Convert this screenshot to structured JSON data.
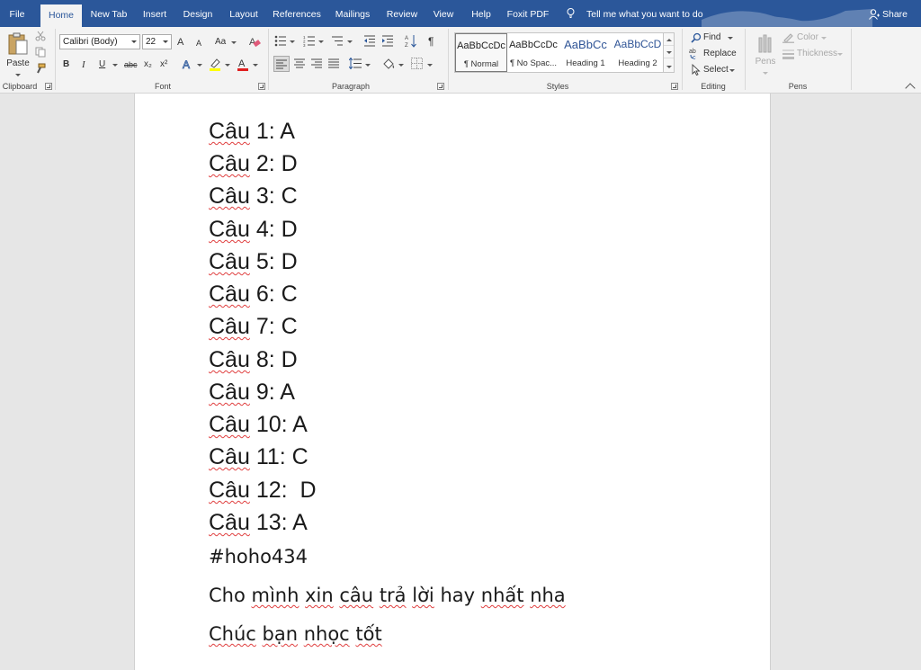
{
  "tabs": [
    "File",
    "Home",
    "New Tab",
    "Insert",
    "Design",
    "Layout",
    "References",
    "Mailings",
    "Review",
    "View",
    "Help",
    "Foxit PDF"
  ],
  "active_tab": "Home",
  "tell_me": "Tell me what you want to do",
  "share": "Share",
  "clipboard": {
    "paste": "Paste",
    "group": "Clipboard"
  },
  "font": {
    "name": "Calibri (Body)",
    "size": "22",
    "group": "Font",
    "bold": "B",
    "italic": "I",
    "underline": "U",
    "strike": "abc",
    "sub": "x₂",
    "sup": "x²",
    "grow": "A",
    "shrink": "A",
    "case": "Aa"
  },
  "paragraph": {
    "group": "Paragraph",
    "pilcrow": "¶"
  },
  "styles": {
    "group": "Styles",
    "items": [
      {
        "sample": "AaBbCcDc",
        "name": "¶ Normal"
      },
      {
        "sample": "AaBbCcDc",
        "name": "¶ No Spac..."
      },
      {
        "sample": "AaBbCc",
        "name": "Heading 1"
      },
      {
        "sample": "AaBbCcD",
        "name": "Heading 2"
      }
    ]
  },
  "editing": {
    "group": "Editing",
    "find": "Find",
    "replace": "Replace",
    "select": "Select"
  },
  "pens": {
    "group": "Pens",
    "pens": "Pens",
    "color": "Color",
    "thickness": "Thickness"
  },
  "document": {
    "answers": [
      {
        "word": "Câu",
        "rest": " 1: A"
      },
      {
        "word": "Câu",
        "rest": " 2: D"
      },
      {
        "word": "Câu",
        "rest": " 3: C"
      },
      {
        "word": "Câu",
        "rest": " 4: D"
      },
      {
        "word": "Câu",
        "rest": " 5: D"
      },
      {
        "word": "Câu",
        "rest": " 6: C"
      },
      {
        "word": "Câu",
        "rest": " 7: C"
      },
      {
        "word": "Câu",
        "rest": " 8: D"
      },
      {
        "word": "Câu",
        "rest": " 9: A"
      },
      {
        "word": "Câu",
        "rest": " 10: A"
      },
      {
        "word": "Câu",
        "rest": " 11: C"
      },
      {
        "word": "Câu",
        "rest": " 12:  D"
      },
      {
        "word": "Câu",
        "rest": " 13: A"
      }
    ],
    "hashtag": "#hoho434",
    "line_request": [
      "Cho",
      "mình",
      "xin",
      "câu",
      "trả",
      "lời",
      "hay",
      "nhất",
      "nha"
    ],
    "line_wish": [
      "Chúc",
      "bạn",
      "nhọc",
      "tốt"
    ]
  }
}
